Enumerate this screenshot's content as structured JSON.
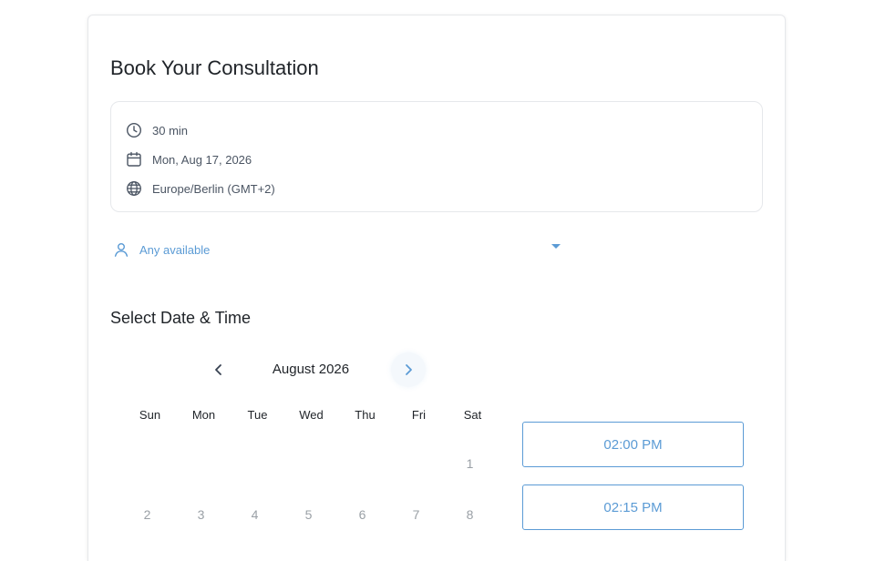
{
  "booking": {
    "title": "Book Your Consultation",
    "duration": "30 min",
    "date": "Mon, Aug 17, 2026",
    "timezone": "Europe/Berlin (GMT+2)"
  },
  "staff_select": {
    "value": "Any available"
  },
  "calendar": {
    "section_title": "Select Date & Time",
    "month_label": "August 2026",
    "weekdays": [
      "Sun",
      "Mon",
      "Tue",
      "Wed",
      "Thu",
      "Fri",
      "Sat"
    ],
    "week1": [
      "",
      "",
      "",
      "",
      "",
      "",
      "1"
    ],
    "week2": [
      "2",
      "3",
      "4",
      "5",
      "6",
      "7",
      "8"
    ]
  },
  "time_slots": [
    "02:00 PM",
    "02:15 PM"
  ],
  "colors": {
    "accent": "#5b9bd5",
    "text": "#1f2328",
    "muted": "#9aa0a6",
    "border": "#e6e8eb"
  },
  "icons": {
    "duration": "clock-icon",
    "date": "calendar-icon",
    "timezone": "globe-icon",
    "staff": "user-icon",
    "dropdown": "caret-down-icon",
    "prev": "chevron-left-icon",
    "next": "chevron-right-icon"
  }
}
